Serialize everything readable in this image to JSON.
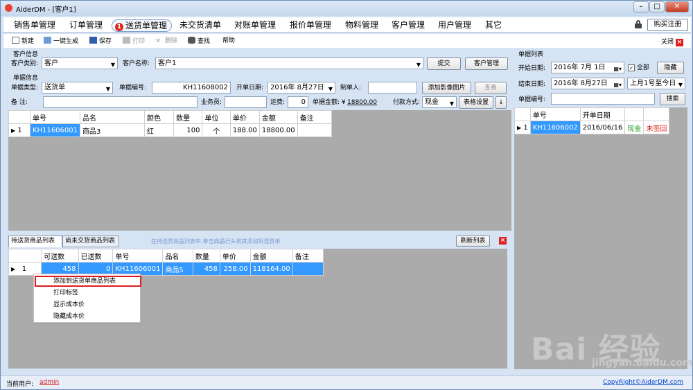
{
  "window": {
    "title": "AiderDM - [客户1]",
    "min": "0",
    "max": "1",
    "close": "r"
  },
  "menu": {
    "items": [
      "销售单管理",
      "订单管理",
      "送货单管理",
      "未交货清单",
      "对账单管理",
      "报价单管理",
      "物料管理",
      "客户管理",
      "用户管理",
      "其它"
    ],
    "active_badge": "1",
    "buy_label": "购买注册"
  },
  "toolbar": {
    "new": "新建",
    "gen": "一键生成",
    "save": "保存",
    "print": "打印",
    "delete": "删除",
    "find": "查找",
    "help": "帮助",
    "close": "关闭"
  },
  "customer": {
    "section": "客户信息",
    "type_label": "客户类别:",
    "type_value": "客户",
    "name_label": "客户名称:",
    "name_value": "客户1",
    "submit": "提交",
    "manage": "客户管理"
  },
  "doc": {
    "section": "单据信息",
    "type_label": "单据类型:",
    "type_value": "送货单",
    "no_label": "单据编号:",
    "no_value": "KH11608002",
    "date_label": "开单日期:",
    "date_value": "2016年 8月27日",
    "maker_label": "制单人:",
    "maker_value": "",
    "add_image": "添加影像图片",
    "view": "查看",
    "remark_label": "备 注:",
    "remark_value": "",
    "salesman_label": "业务员:",
    "salesman_value": "",
    "freight_label": "运费:",
    "freight_value": "0",
    "amount_label": "单据金额: ¥",
    "amount_value": "18800.00",
    "pay_label": "付款方式:",
    "pay_value": "现金",
    "table_setting": "表格设置",
    "arrow": "↓"
  },
  "main_table": {
    "headers": [
      "单号",
      "品名",
      "颜色",
      "数量",
      "单位",
      "单价",
      "金额",
      "备注"
    ],
    "rows": [
      [
        "KH11606001",
        "商品3",
        "红",
        "100",
        "个",
        "188.00",
        "18800.00",
        ""
      ]
    ],
    "row_no": "1"
  },
  "bottom": {
    "tab1": "待送货商品列表",
    "tab2": "尚未交货商品列表",
    "hint": "在待送货商品列表中,单击商品行头将其添加到送货单",
    "refresh": "刷新列表",
    "headers": [
      "可送数",
      "已送数",
      "单号",
      "品名",
      "数量",
      "单价",
      "金额",
      "备注"
    ],
    "rows": [
      [
        "458",
        "0",
        "KH11606001",
        "商品5",
        "458",
        "258.00",
        "118164.00",
        ""
      ]
    ],
    "row_no": "1"
  },
  "context_menu": [
    "添加到送货单商品列表",
    "打印标签",
    "显示成本价",
    "隐藏成本价"
  ],
  "right_panel": {
    "title": "单据列表",
    "start_label": "开始日期:",
    "start_value": "2016年 7月 1日",
    "all_label": "全部",
    "hide": "隐藏",
    "end_label": "结束日期:",
    "end_value": "2016年 8月27日",
    "range_value": "上月1号至今日",
    "no_label": "单据编号:",
    "no_value": "",
    "search": "搜索",
    "headers": [
      "单号",
      "开单日期",
      "",
      ""
    ],
    "rows": [
      [
        "KH11606002",
        "2016/06/16",
        "现金",
        "未签回"
      ]
    ],
    "row_no": "1"
  },
  "status": {
    "user_label": "当前用户:",
    "user": "admin",
    "copyright": "CopyRight©AiderDM.com"
  },
  "watermark": {
    "brand": "Bai 经验",
    "url": "jingyan.baidu.com"
  },
  "colors": {
    "selected": "#3399ff",
    "highlight_box": "#e01c1c",
    "cash_green": "#1f9a1f",
    "unsigned_red": "#e01c1c"
  }
}
